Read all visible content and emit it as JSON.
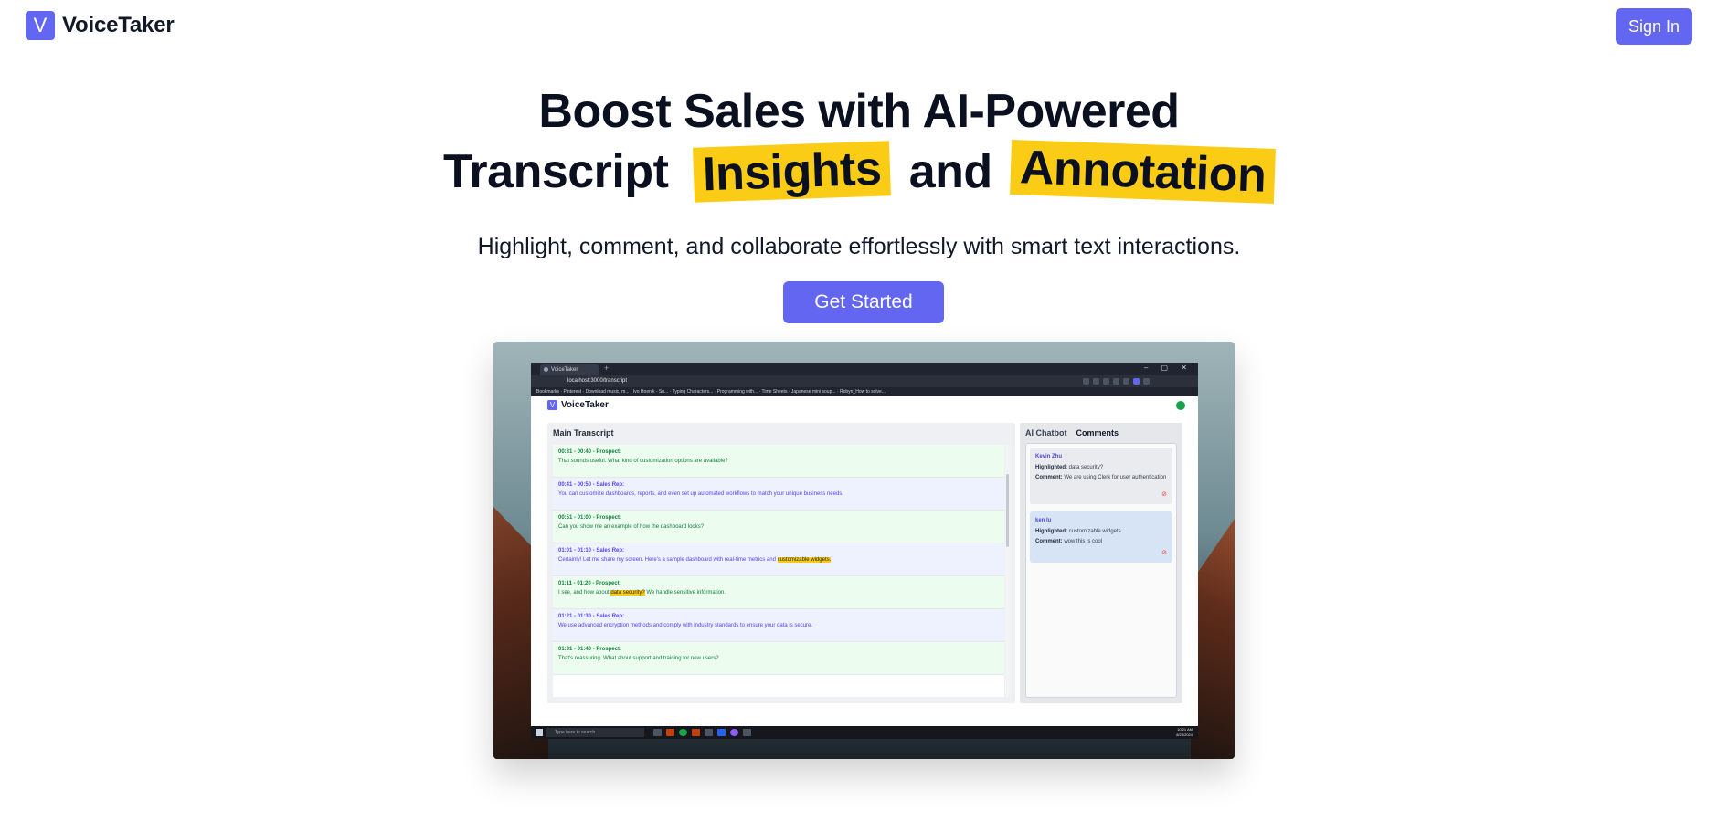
{
  "nav": {
    "logo_letter": "V",
    "brand": "VoiceTaker",
    "signin_label": "Sign In"
  },
  "hero": {
    "title_line1": "Boost Sales with AI-Powered",
    "title_line2_start": "Transcript",
    "highlight_1": "Insights",
    "connector": "and",
    "highlight_2": "Annotation",
    "subtitle": "Highlight, comment, and collaborate effortlessly with smart text interactions.",
    "cta_label": "Get Started",
    "highlight_color": "#facc15",
    "accent_color": "#6366f1"
  },
  "screenshot": {
    "browser": {
      "tab_title": "VoiceTaker",
      "url": "localhost:3000/transcript",
      "bookmarks": "Bookmarks · Pinterest · Download music, m... · Ivo Hoenik - Sn... · Typing Characters... · Programming with... · Time Sheets · Japanese mini soup... · Robyn_How to solve..."
    },
    "app": {
      "logo_letter": "V",
      "brand": "VoiceTaker",
      "transcript_title": "Main Transcript",
      "rows": [
        {
          "speaker": "prospect",
          "header": "00:31 - 00:40 - Prospect:",
          "before": "That sounds useful. What kind of customization options are available?",
          "mark": "",
          "after": ""
        },
        {
          "speaker": "rep",
          "header": "00:41 - 00:50 - Sales Rep:",
          "before": "You can customize dashboards, reports, and even set up automated workflows to match your unique business needs.",
          "mark": "",
          "after": ""
        },
        {
          "speaker": "prospect",
          "header": "00:51 - 01:00 - Prospect:",
          "before": "Can you show me an example of how the dashboard looks?",
          "mark": "",
          "after": ""
        },
        {
          "speaker": "rep",
          "header": "01:01 - 01:10 - Sales Rep:",
          "before": "Certainly! Let me share my screen. Here's a sample dashboard with real-time metrics and ",
          "mark": "customizable widgets.",
          "after": ""
        },
        {
          "speaker": "prospect",
          "header": "01:11 - 01:20 - Prospect:",
          "before": "I see, and how about ",
          "mark": "data security?",
          "after": " We handle sensitive information."
        },
        {
          "speaker": "rep",
          "header": "01:21 - 01:30 - Sales Rep:",
          "before": "We use advanced encryption methods and comply with industry standards to ensure your data is secure.",
          "mark": "",
          "after": ""
        },
        {
          "speaker": "prospect",
          "header": "01:31 - 01:40 - Prospect:",
          "before": "That's reassuring. What about support and training for new users?",
          "mark": "",
          "after": ""
        }
      ],
      "side_tabs": {
        "chat": "AI Chatbot",
        "comments": "Comments"
      },
      "comments": [
        {
          "author": "Kevin Zhu",
          "highlighted_label": "Highlighted:",
          "highlighted": "data security?",
          "comment_label": "Comment:",
          "comment": "We are using Clerk for user authentication"
        },
        {
          "author": "ken lu",
          "highlighted_label": "Highlighted:",
          "highlighted": "customizable widgets.",
          "comment_label": "Comment:",
          "comment": "wow this is cool"
        }
      ]
    },
    "taskbar": {
      "search_placeholder": "Type here to search",
      "time": "10:21 AM",
      "date": "8/23/2024"
    }
  }
}
